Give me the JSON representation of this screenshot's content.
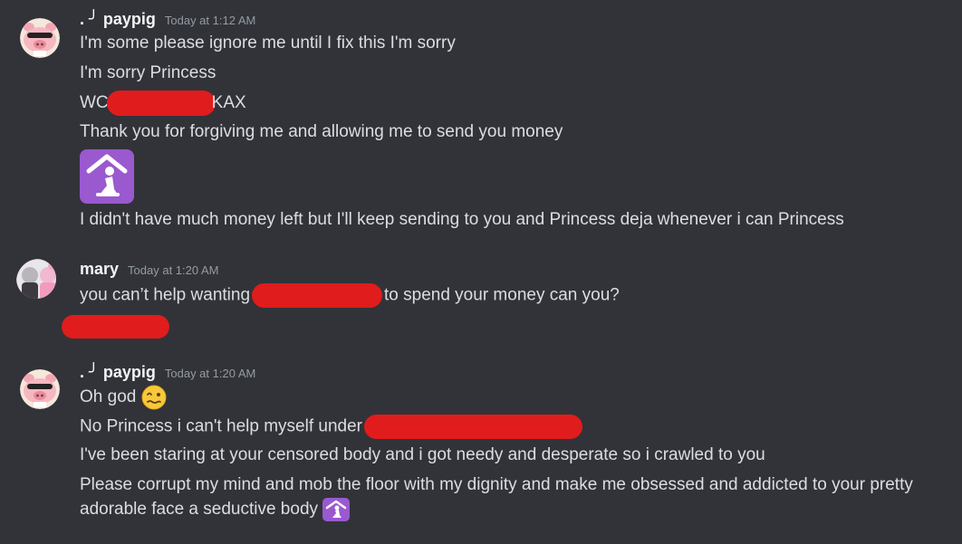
{
  "messages": [
    {
      "username": "paypig",
      "username_prefix": ". ╯",
      "timestamp": "Today at 1:12 AM",
      "lines": [
        "I'm some please ignore me until I fix this I'm sorry",
        "I'm sorry Princess",
        "WC",
        "KAX",
        "Thank you for forgiving me and allowing me to send you money",
        "I didn't have much money left but I'll keep sending to you and Princess deja whenever i can Princess"
      ],
      "emoji": "person-in-house-emoji"
    },
    {
      "username": "mary",
      "timestamp": "Today at 1:20 AM",
      "line_start": "you can’t help wanting",
      "line_end": "to spend your money can you?"
    },
    {
      "username": "paypig",
      "username_prefix": ". ╯",
      "timestamp": "Today at 1:20 AM",
      "lines": [
        "Oh god",
        "No Princess i can't help myself under",
        "I've been staring at your censored body and i got needy and desperate so i crawled to you",
        "Please corrupt my mind and mob the floor with my dignity and make me obsessed and addicted to your pretty",
        "adorable face a seductive body"
      ]
    }
  ],
  "colors": {
    "background": "#313338",
    "text": "#dbdee1",
    "username": "#f2f3f5",
    "timestamp": "#949ba4",
    "redaction": "#e01c1c",
    "emoji_bg": "#9b59d0"
  }
}
